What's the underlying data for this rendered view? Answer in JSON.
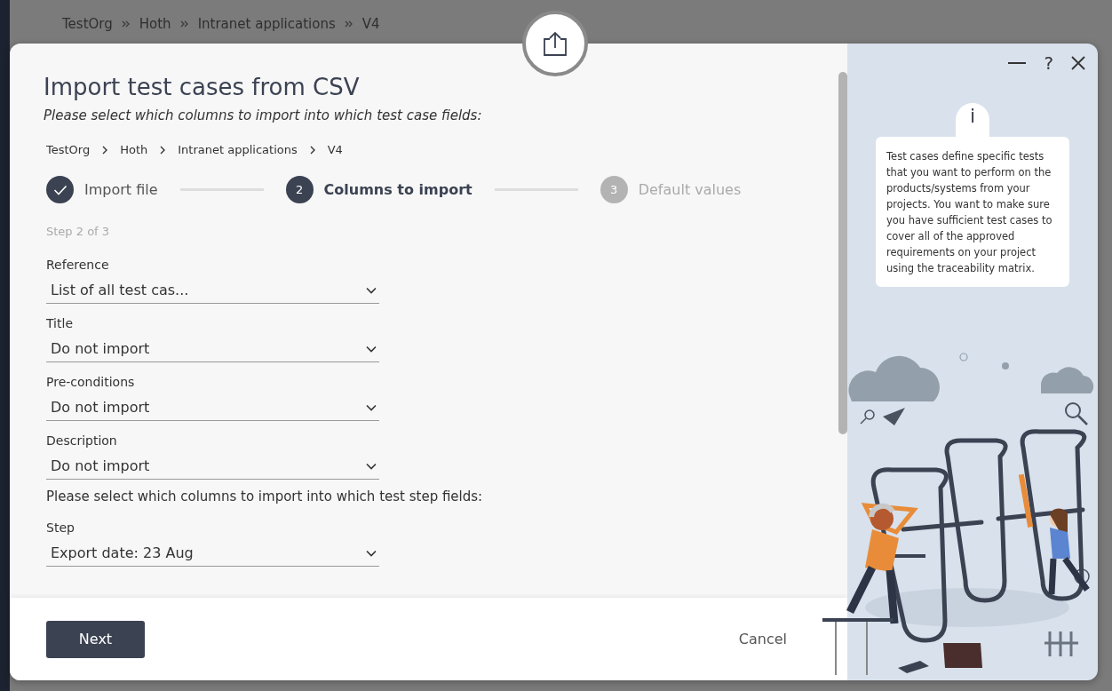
{
  "background": {
    "breadcrumb": [
      "TestOrg",
      "Hoth",
      "Intranet applications",
      "V4"
    ]
  },
  "dialog": {
    "title": "Import test cases from CSV",
    "subtitle": "Please select which columns to import into which test case fields:",
    "breadcrumb": [
      "TestOrg",
      "Hoth",
      "Intranet applications",
      "V4"
    ],
    "steps": [
      {
        "label": "Import file",
        "completed": true,
        "selected": false
      },
      {
        "number": "2",
        "label": "Columns to import",
        "completed": false,
        "selected": true
      },
      {
        "number": "3",
        "label": "Default values",
        "completed": false,
        "selected": false
      }
    ],
    "step_counter": "Step 2 of 3",
    "fields": [
      {
        "kind": "select",
        "label": "Reference",
        "value": "List of all test cas..."
      },
      {
        "kind": "select",
        "label": "Title",
        "value": "Do not import"
      },
      {
        "kind": "select",
        "label": "Pre-conditions",
        "value": "Do not import"
      },
      {
        "kind": "select",
        "label": "Description",
        "value": "Do not import"
      },
      {
        "kind": "note",
        "label": "Please select which columns to import into which test step fields:"
      },
      {
        "kind": "select",
        "label": "Step",
        "value": "Export date: 23 Aug"
      }
    ],
    "buttons": {
      "primary": "Next",
      "secondary": "Cancel"
    },
    "window_controls": {
      "help": "?"
    },
    "info": {
      "badge": "i",
      "text": "Test cases define specific tests that you want to perform on the products/systems from your projects. You want to make sure you have sufficient test cases to cover all of the approved requirements on your project using the traceability matrix."
    }
  }
}
